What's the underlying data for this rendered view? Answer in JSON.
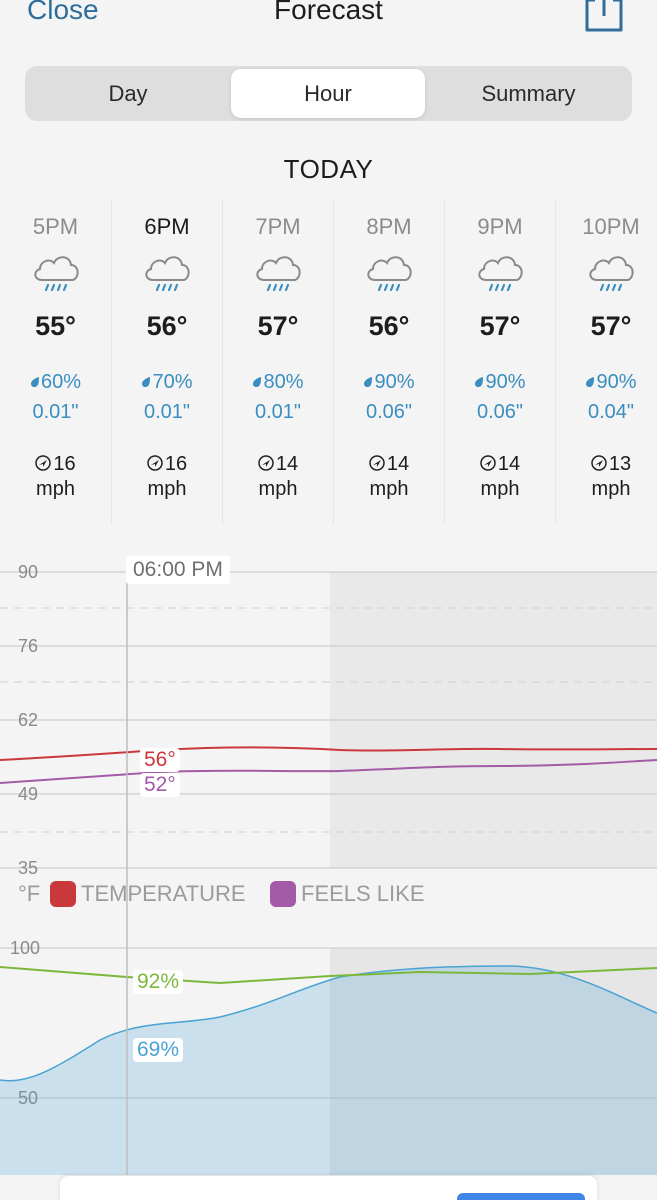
{
  "header": {
    "close_label": "Close",
    "title": "Forecast",
    "share_icon": "share-icon"
  },
  "tabs": [
    {
      "label": "Day",
      "active": false
    },
    {
      "label": "Hour",
      "active": true
    },
    {
      "label": "Summary",
      "active": false
    }
  ],
  "section_title": "TODAY",
  "hours": [
    {
      "time": "5PM",
      "icon": "rain-cloud-icon",
      "temp": "55°",
      "precip_chance": "60%",
      "precip_amount": "0.01\"",
      "wind": "16",
      "wind_unit": "mph"
    },
    {
      "time": "6PM",
      "icon": "rain-cloud-icon",
      "temp": "56°",
      "precip_chance": "70%",
      "precip_amount": "0.01\"",
      "wind": "16",
      "wind_unit": "mph"
    },
    {
      "time": "7PM",
      "icon": "rain-cloud-icon",
      "temp": "57°",
      "precip_chance": "80%",
      "precip_amount": "0.01\"",
      "wind": "14",
      "wind_unit": "mph"
    },
    {
      "time": "8PM",
      "icon": "rain-cloud-icon",
      "temp": "56°",
      "precip_chance": "90%",
      "precip_amount": "0.06\"",
      "wind": "14",
      "wind_unit": "mph"
    },
    {
      "time": "9PM",
      "icon": "rain-cloud-icon",
      "temp": "57°",
      "precip_chance": "90%",
      "precip_amount": "0.06\"",
      "wind": "14",
      "wind_unit": "mph"
    },
    {
      "time": "10PM",
      "icon": "rain-cloud-icon",
      "temp": "57°",
      "precip_chance": "90%",
      "precip_amount": "0.04\"",
      "wind": "13",
      "wind_unit": "mph"
    }
  ],
  "temp_chart": {
    "cursor_time": "06:00 PM",
    "y_ticks": [
      "90",
      "76",
      "62",
      "49",
      "35"
    ],
    "unit": "°F",
    "legend": [
      {
        "label": "TEMPERATURE",
        "color": "#c9383a"
      },
      {
        "label": "FEELS LIKE",
        "color": "#a35aa7"
      }
    ],
    "temperature_value": "56°",
    "feels_like_value": "52°",
    "temp_color": "#c9383a",
    "feels_color": "#a35aa7"
  },
  "humidity_chart": {
    "y_ticks": [
      "100",
      "50"
    ],
    "line_value": "92%",
    "area_value": "69%",
    "line_color": "#7bb83a",
    "area_color": "#4aa3d3"
  },
  "colors": {
    "accent": "#2f6e9a",
    "precip": "#3b8ec0"
  }
}
